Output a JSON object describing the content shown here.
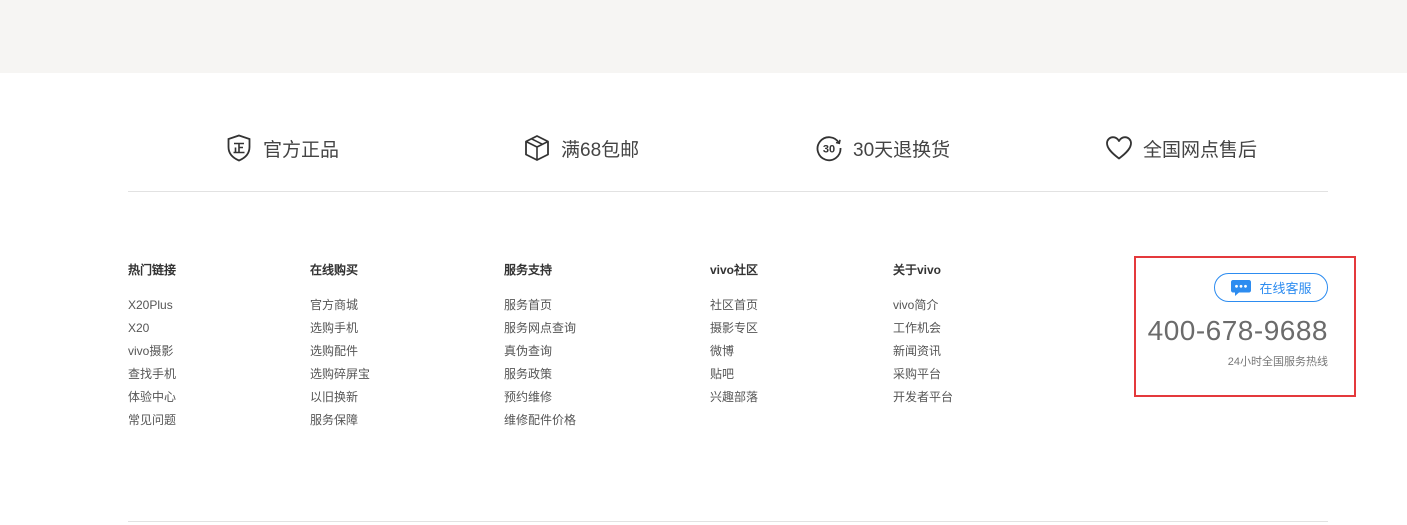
{
  "promises": [
    {
      "icon": "shield-genuine-icon",
      "label": "官方正品"
    },
    {
      "icon": "box-icon",
      "label": "满68包邮"
    },
    {
      "icon": "30-days-return-icon",
      "label": "30天退换货"
    },
    {
      "icon": "heart-icon",
      "label": "全国网点售后"
    }
  ],
  "footer_columns": [
    {
      "title": "热门链接",
      "links": [
        "X20Plus",
        "X20",
        "vivo摄影",
        "查找手机",
        "体验中心",
        "常见问题"
      ]
    },
    {
      "title": "在线购买",
      "links": [
        "官方商城",
        "选购手机",
        "选购配件",
        "选购碎屏宝",
        "以旧换新",
        "服务保障"
      ]
    },
    {
      "title": "服务支持",
      "links": [
        "服务首页",
        "服务网点查询",
        "真伪查询",
        "服务政策",
        "预约维修",
        "维修配件价格"
      ]
    },
    {
      "title": "vivo社区",
      "links": [
        "社区首页",
        "摄影专区",
        "微博",
        "贴吧",
        "兴趣部落"
      ]
    },
    {
      "title": "关于vivo",
      "links": [
        "vivo简介",
        "工作机会",
        "新闻资讯",
        "采购平台",
        "开发者平台"
      ]
    }
  ],
  "service": {
    "chat_label": "在线客服",
    "hotline": "400-678-9688",
    "hotline_note": "24小时全国服务热线",
    "icon": "chat-bubble-icon"
  },
  "colors": {
    "accent_blue": "#2d8cf0",
    "highlight_red": "#e4393c",
    "top_band": "#f6f5f3"
  }
}
